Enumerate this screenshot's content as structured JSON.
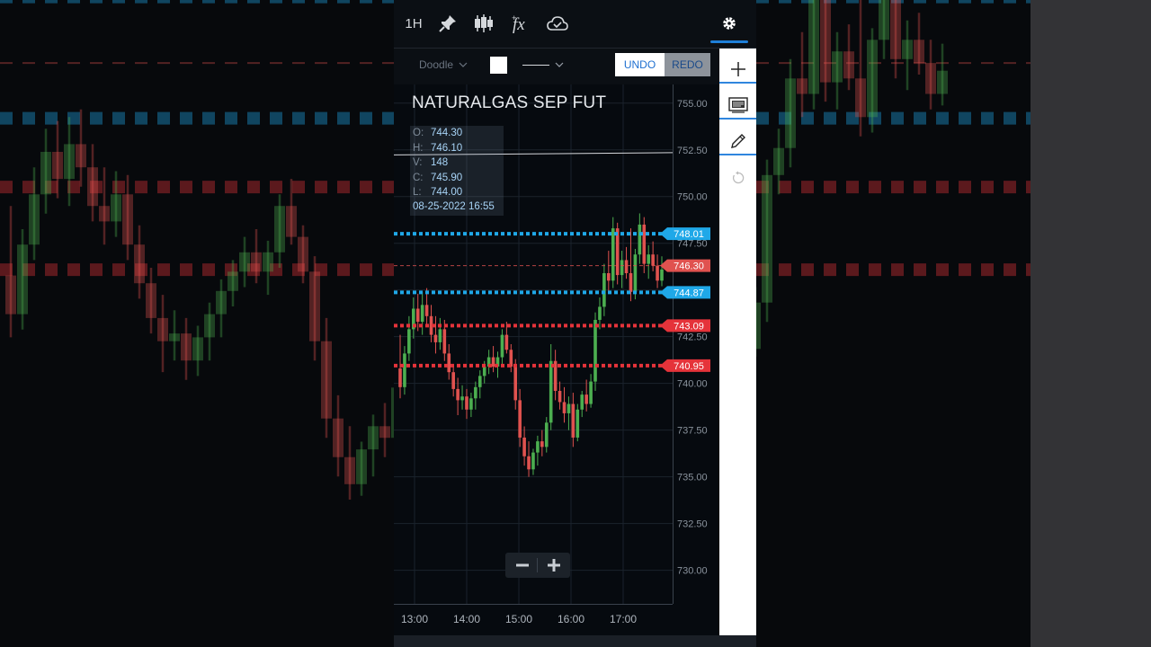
{
  "toolbar": {
    "interval_label": "1H",
    "icons": [
      "pin-icon",
      "candlestick-icon",
      "fx-icon",
      "cloud-icon",
      "gear-icon"
    ]
  },
  "drawing_bar": {
    "tool_label": "Doodle",
    "color": "#ffffff",
    "undo_label": "UNDO",
    "redo_label": "REDO"
  },
  "sidebar": {
    "icons": [
      "plus-icon",
      "notes-icon",
      "pencil-icon",
      "reset-icon"
    ]
  },
  "ohlc": {
    "o_label": "O:",
    "o": "744.30",
    "h_label": "H:",
    "h": "746.10",
    "v_label": "V:",
    "v": "148",
    "c_label": "C:",
    "c": "745.90",
    "l_label": "L:",
    "l": "744.00",
    "date": "08-25-2022 16:55"
  },
  "colors": {
    "up": "#4caf50",
    "down": "#e0524f",
    "blue_line": "#1fa8e8",
    "red_line": "#e5333a",
    "accent": "#1e7fd8"
  },
  "chart_data": {
    "type": "candlestick",
    "title": "NATURALGAS SEP FUT",
    "x_ticks": [
      "13:00",
      "14:00",
      "15:00",
      "16:00",
      "17:00"
    ],
    "y_ticks": [
      "755.00",
      "752.50",
      "750.00",
      "747.50",
      "745.00",
      "742.50",
      "740.00",
      "737.50",
      "735.00",
      "732.50",
      "730.00"
    ],
    "ylim": [
      728.2,
      756.0
    ],
    "hlines": [
      {
        "value": 748.01,
        "label": "748.01",
        "color": "#1fa8e8",
        "style": "dotted"
      },
      {
        "value": 746.3,
        "label": "746.30",
        "color": "#e0524f",
        "style": "dashed"
      },
      {
        "value": 744.87,
        "label": "744.87",
        "color": "#1fa8e8",
        "style": "dotted"
      },
      {
        "value": 743.09,
        "label": "743.09",
        "color": "#e5333a",
        "style": "dotted"
      },
      {
        "value": 740.95,
        "label": "740.95",
        "color": "#e5333a",
        "style": "dotted"
      }
    ],
    "reference_line": {
      "value": 752.3
    },
    "candles": [
      [
        740.8,
        742.6,
        739.2,
        739.8
      ],
      [
        739.8,
        742.0,
        739.4,
        741.6
      ],
      [
        741.6,
        743.6,
        741.2,
        742.9
      ],
      [
        742.9,
        744.6,
        742.4,
        744.0
      ],
      [
        744.0,
        744.8,
        742.8,
        743.3
      ],
      [
        743.3,
        744.9,
        742.6,
        744.2
      ],
      [
        744.2,
        745.1,
        743.1,
        743.6
      ],
      [
        743.6,
        744.2,
        742.2,
        742.6
      ],
      [
        742.6,
        743.6,
        741.6,
        742.2
      ],
      [
        742.2,
        743.5,
        741.8,
        742.9
      ],
      [
        742.9,
        743.4,
        741.2,
        741.6
      ],
      [
        741.6,
        742.1,
        740.2,
        740.6
      ],
      [
        740.6,
        741.0,
        739.3,
        739.7
      ],
      [
        739.7,
        740.3,
        738.3,
        739.1
      ],
      [
        739.1,
        739.9,
        738.6,
        739.3
      ],
      [
        739.3,
        739.7,
        738.1,
        738.6
      ],
      [
        738.6,
        739.5,
        738.2,
        739.2
      ],
      [
        739.2,
        740.1,
        738.6,
        739.8
      ],
      [
        739.8,
        740.7,
        739.2,
        740.4
      ],
      [
        740.4,
        741.2,
        740.0,
        740.9
      ],
      [
        740.9,
        741.8,
        740.5,
        741.4
      ],
      [
        741.4,
        742.0,
        740.6,
        740.9
      ],
      [
        740.9,
        741.7,
        740.3,
        741.4
      ],
      [
        741.4,
        742.9,
        741.0,
        742.6
      ],
      [
        742.6,
        743.3,
        741.6,
        741.8
      ],
      [
        741.8,
        742.1,
        740.6,
        740.9
      ],
      [
        740.9,
        741.3,
        738.6,
        739.1
      ],
      [
        739.1,
        739.7,
        736.6,
        737.1
      ],
      [
        737.1,
        737.7,
        735.6,
        736.1
      ],
      [
        736.1,
        736.9,
        735.0,
        735.4
      ],
      [
        735.4,
        736.5,
        735.1,
        736.3
      ],
      [
        736.3,
        737.2,
        735.6,
        736.9
      ],
      [
        736.9,
        737.5,
        736.1,
        736.6
      ],
      [
        736.6,
        738.2,
        736.3,
        737.9
      ],
      [
        737.9,
        742.1,
        737.5,
        741.2
      ],
      [
        741.2,
        741.8,
        739.1,
        739.6
      ],
      [
        739.6,
        740.1,
        738.6,
        739.0
      ],
      [
        739.0,
        739.8,
        737.9,
        738.4
      ],
      [
        738.4,
        739.3,
        737.5,
        738.9
      ],
      [
        738.9,
        739.5,
        736.6,
        737.1
      ],
      [
        737.1,
        738.9,
        736.9,
        738.6
      ],
      [
        738.6,
        739.6,
        738.2,
        739.4
      ],
      [
        739.4,
        740.2,
        738.5,
        738.9
      ],
      [
        738.9,
        740.5,
        738.7,
        740.1
      ],
      [
        740.1,
        743.8,
        739.6,
        743.4
      ],
      [
        743.4,
        744.6,
        742.9,
        744.1
      ],
      [
        744.1,
        746.4,
        743.6,
        745.9
      ],
      [
        745.9,
        747.1,
        744.9,
        745.5
      ],
      [
        745.5,
        748.9,
        745.1,
        748.3
      ],
      [
        748.3,
        748.6,
        745.3,
        745.8
      ],
      [
        745.8,
        747.1,
        745.1,
        746.6
      ],
      [
        746.6,
        747.3,
        745.6,
        745.9
      ],
      [
        745.9,
        748.3,
        744.4,
        744.9
      ],
      [
        744.9,
        747.2,
        744.5,
        746.9
      ],
      [
        746.9,
        749.1,
        746.4,
        748.5
      ],
      [
        748.5,
        748.9,
        745.9,
        746.4
      ],
      [
        746.4,
        747.4,
        745.6,
        746.9
      ],
      [
        746.9,
        747.6,
        746.0,
        746.3
      ],
      [
        746.3,
        746.9,
        745.1,
        745.5
      ],
      [
        745.5,
        746.8,
        745.2,
        746.1
      ]
    ]
  }
}
